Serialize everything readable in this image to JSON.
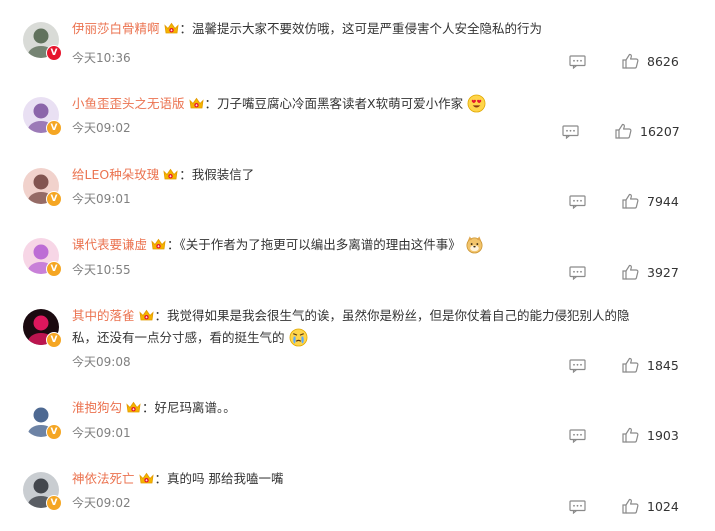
{
  "comments": [
    {
      "username": "伊丽莎白骨精啊",
      "separator": "：",
      "text": "温馨提示大家不要效仿哦，这可是严重侵害个人安全隐私的行为",
      "text_line2": "",
      "time": "今天10:36",
      "likes": "8626",
      "badge": "red",
      "badge_icon": "v-verified-icon",
      "avatar_colors": [
        "#d9dbd7",
        "#4b5f48"
      ],
      "emoji": null
    },
    {
      "username": "小鱼歪歪头之无语版",
      "separator": "：",
      "text": "刀子嘴豆腐心冷面黑客读者X软萌可爱小作家",
      "text_line2": "",
      "time": "今天09:02",
      "likes": "16207",
      "badge": "yellow",
      "badge_icon": "v-verified-icon",
      "avatar_colors": [
        "#e9e0f3",
        "#7a4f9c"
      ],
      "emoji": "heart-eyes-emoji"
    },
    {
      "username": "给LEO种朵玫瑰",
      "separator": "：",
      "text": "我假装信了",
      "text_line2": "",
      "time": "今天09:01",
      "likes": "7944",
      "badge": "yellow",
      "badge_icon": "v-verified-icon",
      "avatar_colors": [
        "#f1d2cc",
        "#6e3e3a"
      ],
      "emoji": null
    },
    {
      "username": "课代表要谦虚",
      "separator": "：",
      "text": "《关于作者为了拖更可以编出多离谱的理由这件事》",
      "text_line2": "",
      "time": "今天10:55",
      "likes": "3927",
      "badge": "yellow",
      "badge_icon": "v-verified-icon",
      "avatar_colors": [
        "#f7d6e6",
        "#b35bd1"
      ],
      "emoji": "doge-emoji"
    },
    {
      "username": "其中的落雀",
      "separator": "：",
      "text": "我觉得如果是我会很生气的诶，虽然你是粉丝，但是你仗着自己的能力侵犯别人的隐",
      "text_line2": "私，还没有一点分寸感，看的挺生气的",
      "time": "今天09:08",
      "likes": "1845",
      "badge": "yellow",
      "badge_icon": "v-verified-icon",
      "avatar_colors": [
        "#1b0a10",
        "#ff1a6b"
      ],
      "emoji": "angry-tears-emoji"
    },
    {
      "username": "淮抱狗勾",
      "separator": "：",
      "text": "好尼玛离谱。。",
      "text_line2": "",
      "time": "今天09:01",
      "likes": "1903",
      "badge": "yellow",
      "badge_icon": "v-verified-icon",
      "avatar_colors": [
        "#ffffff",
        "#2f4f7f"
      ],
      "emoji": null
    },
    {
      "username": "神依法死亡",
      "separator": "：",
      "text": "真的吗 那给我嗑一嘴",
      "text_line2": "",
      "time": "今天09:02",
      "likes": "1024",
      "badge": "yellow",
      "badge_icon": "v-verified-icon",
      "avatar_colors": [
        "#c9cdd1",
        "#2b2f36"
      ],
      "emoji": null
    }
  ],
  "colors": {
    "username": "#eb7350",
    "text": "#333333",
    "time": "#808080",
    "icon": "#8a8a8a",
    "badge_yellow": "#f5a623",
    "badge_red": "#e6162d"
  }
}
